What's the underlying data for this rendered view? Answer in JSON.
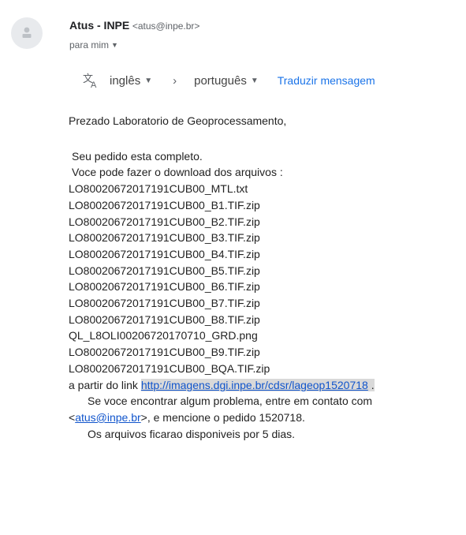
{
  "sender": {
    "name": "Atus - INPE",
    "email": "<atus@inpe.br>"
  },
  "recipient_label": "para mim",
  "translate": {
    "from_lang": "inglês",
    "to_lang": "português",
    "action": "Traduzir mensagem"
  },
  "message": {
    "greeting": "Prezado  Laboratorio de Geoprocessamento,",
    "completed": "Seu pedido esta completo.",
    "download_intro": "Voce pode fazer o download dos arquivos :",
    "files": [
      "LO80020672017191CUB00_MTL.txt",
      "LO80020672017191CUB00_B1.TIF.zip",
      "LO80020672017191CUB00_B2.TIF.zip",
      "LO80020672017191CUB00_B3.TIF.zip",
      "LO80020672017191CUB00_B4.TIF.zip",
      "LO80020672017191CUB00_B5.TIF.zip",
      "LO80020672017191CUB00_B6.TIF.zip",
      "LO80020672017191CUB00_B7.TIF.zip",
      "LO80020672017191CUB00_B8.TIF.zip",
      "QL_L8OLI00206720170710_GRD.png",
      "LO80020672017191CUB00_B9.TIF.zip",
      "LO80020672017191CUB00_BQA.TIF.zip"
    ],
    "link_prefix": "a partir do link ",
    "link_url": "http://imagens.dgi.inpe.br/cdsr/lageop1520718",
    "link_suffix": " .",
    "problem_line": "Se voce encontrar algum problema, entre em contato com",
    "contact_open": "<",
    "contact_email": "atus@inpe.br",
    "contact_rest": ">, e mencione o pedido 1520718.",
    "availability": "Os arquivos ficarao disponiveis por 5 dias."
  }
}
